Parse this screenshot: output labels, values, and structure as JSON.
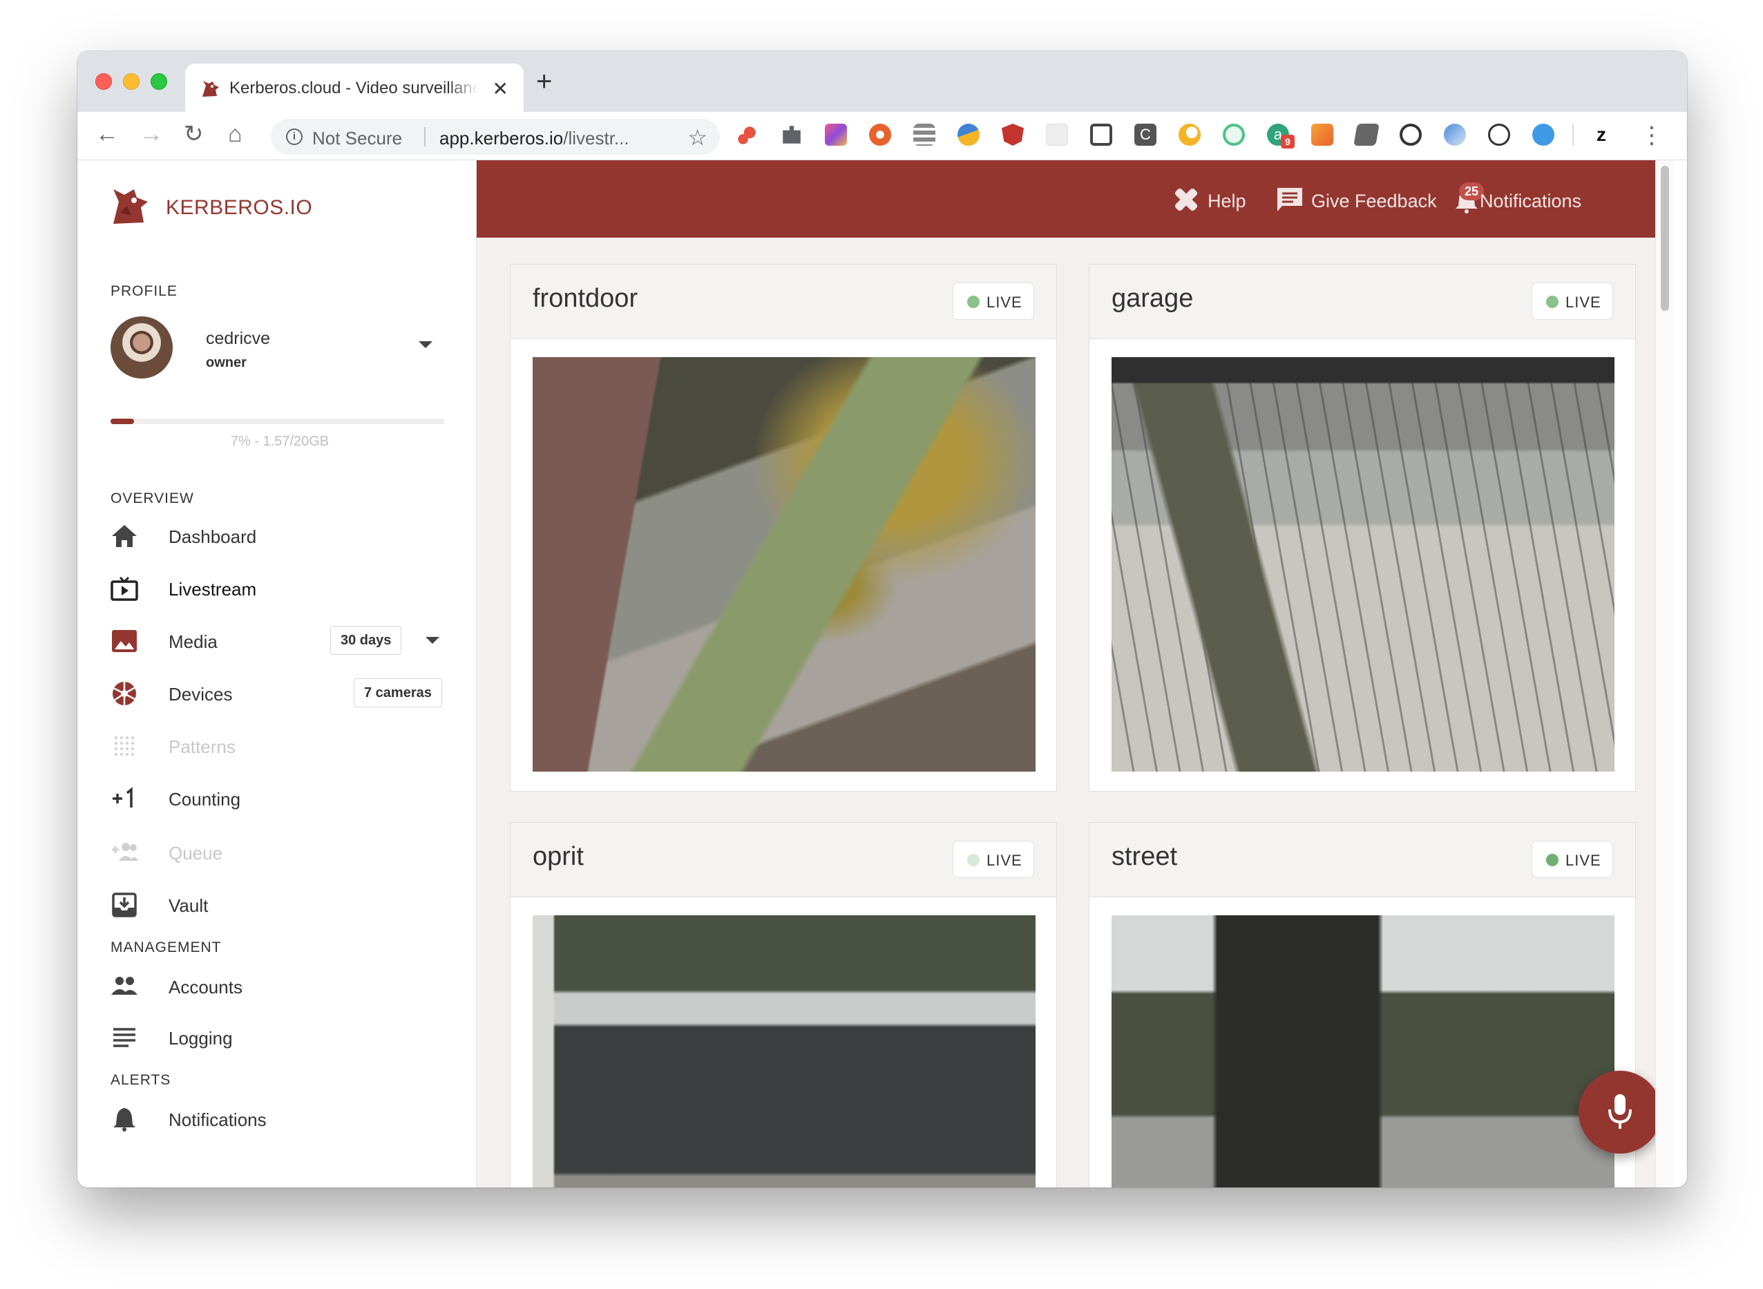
{
  "browser": {
    "tab_title": "Kerberos.cloud - Video surveillance",
    "not_secure": "Not Secure",
    "url_host": "app.kerberos.io",
    "url_path": "/livestr...",
    "extension_badge": "9",
    "accent_tab_icon": "#943630"
  },
  "brand": {
    "name": "KERBEROS.IO",
    "color": "#943630"
  },
  "sidebar": {
    "profile_label": "PROFILE",
    "user": {
      "name": "cedricve",
      "role": "owner"
    },
    "storage": {
      "text": "7% - 1.57/20GB",
      "percent": 7
    },
    "overview_label": "OVERVIEW",
    "overview_items": [
      {
        "label": "Dashboard",
        "icon": "home-icon"
      },
      {
        "label": "Livestream",
        "icon": "tv-icon"
      },
      {
        "label": "Media",
        "icon": "image-icon",
        "badge": "30 days"
      },
      {
        "label": "Devices",
        "icon": "camera-shutter-icon",
        "badge": "7 cameras"
      },
      {
        "label": "Patterns",
        "icon": "grid-dots-icon",
        "disabled": true
      },
      {
        "label": "Counting",
        "icon": "plus-one-icon"
      },
      {
        "label": "Queue",
        "icon": "group-add-icon",
        "disabled": true
      },
      {
        "label": "Vault",
        "icon": "vault-icon"
      }
    ],
    "management_label": "MANAGEMENT",
    "management_items": [
      {
        "label": "Accounts",
        "icon": "people-icon"
      },
      {
        "label": "Logging",
        "icon": "list-icon"
      }
    ],
    "alerts_label": "ALERTS",
    "alerts_items": [
      {
        "label": "Notifications",
        "icon": "bell-icon"
      }
    ]
  },
  "topbar": {
    "help": "Help",
    "feedback": "Give Feedback",
    "notifications": "Notifications",
    "notifications_count": "25",
    "color": "#943630"
  },
  "cameras": [
    {
      "name": "frontdoor",
      "status": "LIVE",
      "live_color": "#8bc28c"
    },
    {
      "name": "garage",
      "status": "LIVE",
      "live_color": "#8bc28c"
    },
    {
      "name": "oprit",
      "status": "LIVE",
      "live_color": "#d6ead6"
    },
    {
      "name": "street",
      "status": "LIVE",
      "live_color": "#6fb06f"
    }
  ]
}
